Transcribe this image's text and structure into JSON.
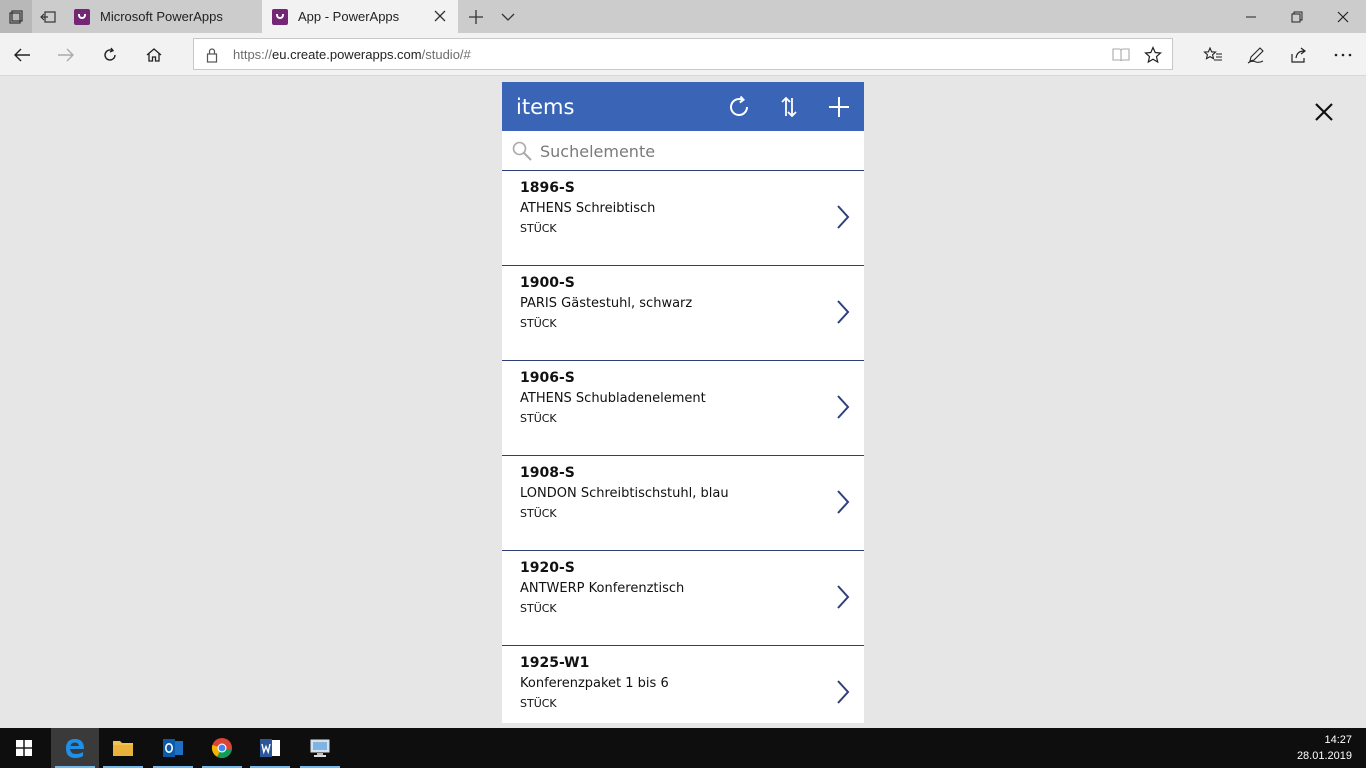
{
  "browser": {
    "tabs": [
      {
        "label": "Microsoft PowerApps",
        "icon": "powerapps-icon",
        "active": false
      },
      {
        "label": "App - PowerApps",
        "icon": "powerapps-icon",
        "active": true
      }
    ],
    "url_prefix": "https://",
    "url_host": "eu.create.powerapps.com",
    "url_path": "/studio/#"
  },
  "app": {
    "title": "items",
    "search_placeholder": "Suchelemente",
    "header_color": "#3a65b7",
    "items": [
      {
        "code": "1896-S",
        "description": "ATHENS Schreibtisch",
        "unit": "STÜCK"
      },
      {
        "code": "1900-S",
        "description": "PARIS Gästestuhl, schwarz",
        "unit": "STÜCK"
      },
      {
        "code": "1906-S",
        "description": "ATHENS Schubladenelement",
        "unit": "STÜCK"
      },
      {
        "code": "1908-S",
        "description": "LONDON Schreibtischstuhl, blau",
        "unit": "STÜCK"
      },
      {
        "code": "1920-S",
        "description": "ANTWERP Konferenztisch",
        "unit": "STÜCK"
      },
      {
        "code": "1925-W1",
        "description": "Konferenzpaket 1 bis 6",
        "unit": "STÜCK"
      }
    ]
  },
  "taskbar": {
    "time": "14:27",
    "date": "28.01.2019"
  }
}
